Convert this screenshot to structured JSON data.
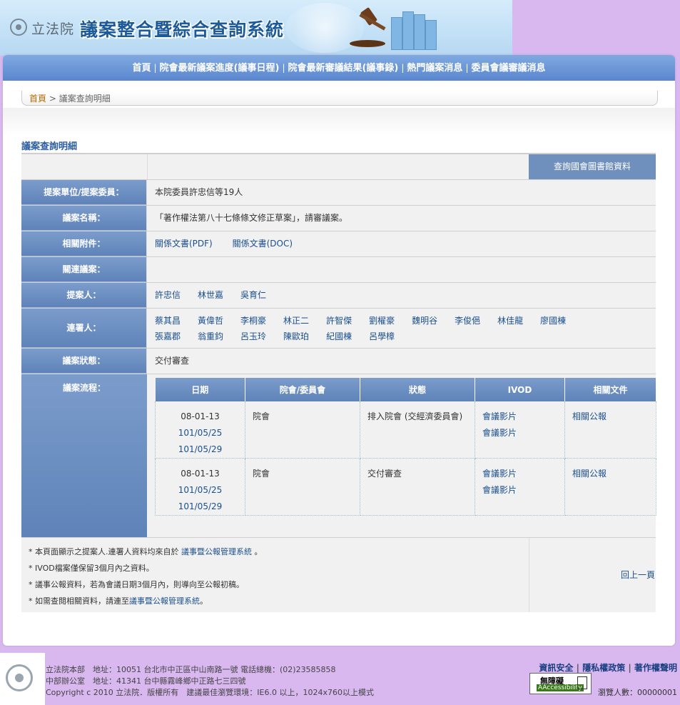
{
  "header": {
    "org": "立法院",
    "title": "議案整合暨綜合查詢系統"
  },
  "nav": {
    "items": [
      "首頁",
      "院會最新議案進度(議事日程)",
      "院會最新審議結果(議事錄)",
      "熱門議案消息",
      "委員會議審議消息"
    ]
  },
  "breadcrumb": {
    "home": "首頁",
    "sep": ">",
    "current": "議案查詢明細"
  },
  "page_title": "議案查詢明細",
  "library_button": "查詢國會圖書館資料",
  "fields": {
    "proposer_unit": {
      "label": "提案單位/提案委員：",
      "value": "本院委員許忠信等19人"
    },
    "bill_name": {
      "label": "議案名稱：",
      "value": "「著作權法第八十七條條文修正草案」，請審議案。"
    },
    "attachments": {
      "label": "相關附件：",
      "links": [
        "關係文書(PDF)",
        "關係文書(DOC)"
      ]
    },
    "related_bills": {
      "label": "關連議案：",
      "value": ""
    },
    "proposers": {
      "label": "提案人：",
      "names": [
        "許忠信",
        "林世嘉",
        "吳育仁"
      ]
    },
    "cosigners": {
      "label": "連署人：",
      "row1": [
        "蔡其昌",
        "黃偉哲",
        "李桐豪",
        "林正二",
        "許智傑",
        "劉櫂豪",
        "魏明谷",
        "李俊俋",
        "林佳龍",
        "廖國棟"
      ],
      "row2": [
        "張嘉郡",
        "翁重鈞",
        "呂玉玲",
        "陳歐珀",
        "紀國棟",
        "呂學樟"
      ]
    },
    "status": {
      "label": "議案狀態：",
      "value": "交付審查"
    },
    "process": {
      "label": "議案流程："
    }
  },
  "process_table": {
    "headers": [
      "日期",
      "院會/委員會",
      "狀態",
      "IVOD",
      "相關文件"
    ],
    "rows": [
      {
        "date": "08-01-13",
        "date2": "101/05/25",
        "date3": "101/05/29",
        "body": "院會",
        "state": "排入院會 (交經濟委員會)",
        "ivod1": "會議影片",
        "ivod2": "會議影片",
        "doc": "相關公報"
      },
      {
        "date": "08-01-13",
        "date2": "101/05/25",
        "date3": "101/05/29",
        "body": "院會",
        "state": "交付審查",
        "ivod1": "會議影片",
        "ivod2": "會議影片",
        "doc": "相關公報"
      }
    ]
  },
  "notes": {
    "n1_pre": "* 本頁面顯示之提案人.連署人資料均來自於 ",
    "n1_link": "議事暨公報管理系統",
    "n1_post": " 。",
    "n2": "* IVOD檔案僅保留3個月內之資料。",
    "n3": "* 議事公報資料，若為會議日期3個月內，則導向至公報初稿。",
    "n4_pre": "* 如需查閱相關資料，請連至",
    "n4_link": "議事暨公報管理系統",
    "n4_post": "。",
    "back": "回上一頁"
  },
  "footer": {
    "line1": "立法院本部　地址：10051 台北市中正區中山南路一號 電話總機：(02)23585858",
    "line2": "中部辦公室　地址：41341 台中縣霧峰鄉中正路七三四號",
    "line3": "Copyright c 2010 立法院．版權所有　建議最佳瀏覽環境：IE6.0 以上，1024x760以上模式",
    "links": [
      "資訊安全",
      "隱私權政策",
      "著作權聲明"
    ],
    "aa_top": "無障礙",
    "aa_bottom": "AAccessibility",
    "visits": "瀏覽人數：00000001"
  }
}
